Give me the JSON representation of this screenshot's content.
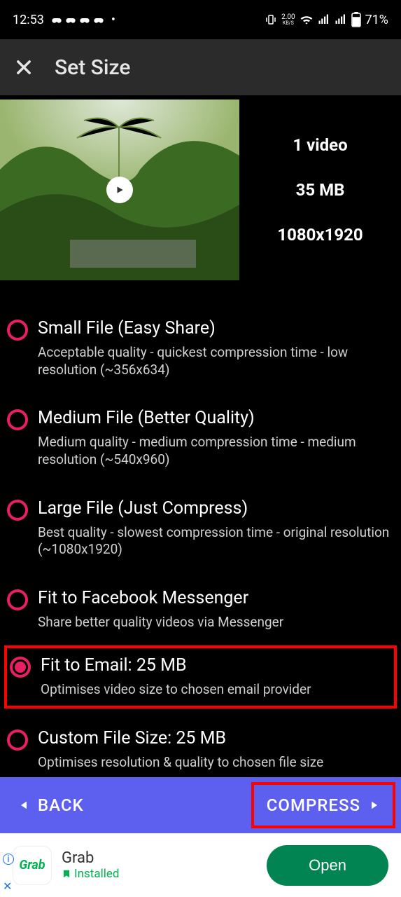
{
  "status": {
    "time": "12:53",
    "net_speed": "2.00",
    "net_unit": "KB/S",
    "battery": "71%"
  },
  "header": {
    "title": "Set Size"
  },
  "video": {
    "count": "1 video",
    "size": "35 MB",
    "resolution": "1080x1920"
  },
  "options": [
    {
      "title": "Small File (Easy Share)",
      "sub": "Acceptable quality - quickest compression time - low resolution (~356x634)",
      "selected": false
    },
    {
      "title": "Medium File (Better Quality)",
      "sub": "Medium quality - medium compression time - medium resolution (~540x960)",
      "selected": false
    },
    {
      "title": "Large File (Just Compress)",
      "sub": "Best quality - slowest compression time - original resolution (~1080x1920)",
      "selected": false
    },
    {
      "title": "Fit to Facebook Messenger",
      "sub": "Share better quality videos via Messenger",
      "selected": false
    },
    {
      "title": "Fit to Email: 25 MB",
      "sub": "Optimises video size to chosen email provider",
      "selected": true
    },
    {
      "title": "Custom File Size: 25 MB",
      "sub": "Optimises resolution & quality to chosen file size",
      "selected": false
    }
  ],
  "buttons": {
    "back": "BACK",
    "compress": "COMPRESS"
  },
  "ad": {
    "name": "Grab",
    "status": "Installed",
    "cta": "Open",
    "logo": "Grab"
  }
}
